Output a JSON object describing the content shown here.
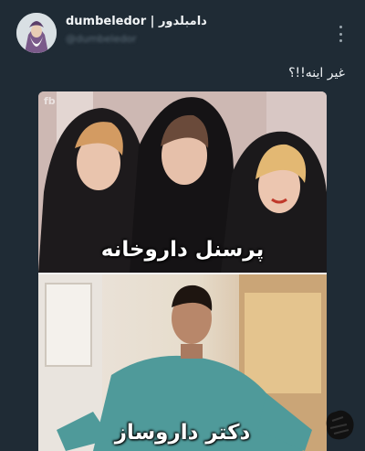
{
  "post": {
    "display_name": "dumbeledor | دامبلدور",
    "handle": "@dumbeledor",
    "caption": "غیر اینه!!؟",
    "more_icon": "more-vertical-icon"
  },
  "meme": {
    "watermark": "fb",
    "top_text": "پرسنل داروخانه",
    "bottom_text": "دکتر داروساز"
  },
  "colors": {
    "background": "#1f2b35",
    "text": "#eef2f5",
    "muted": "#5f6f7b"
  }
}
